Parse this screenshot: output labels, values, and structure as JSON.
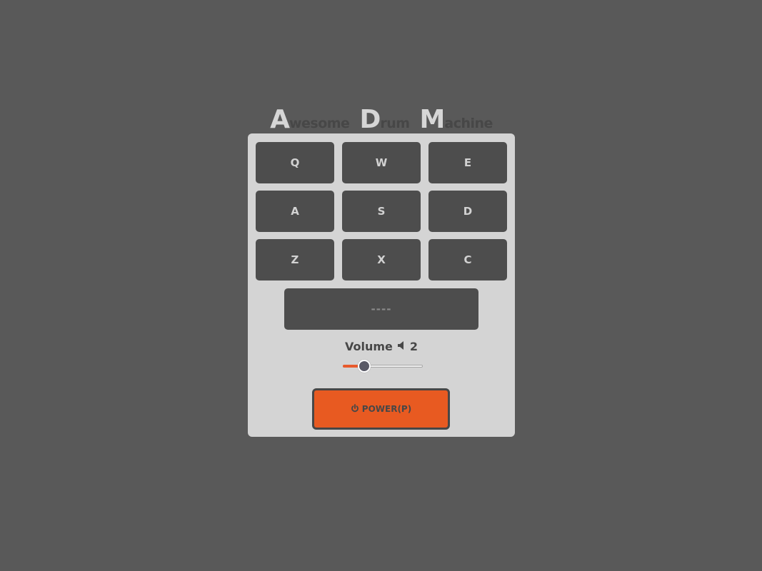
{
  "title": {
    "words": [
      {
        "initial": "A",
        "rest": "wesome"
      },
      {
        "initial": "D",
        "rest": "rum"
      },
      {
        "initial": "M",
        "rest": "achine"
      }
    ]
  },
  "pads": {
    "row1": [
      "Q",
      "W",
      "E"
    ],
    "row2": [
      "A",
      "S",
      "D"
    ],
    "row3": [
      "Z",
      "X",
      "C"
    ]
  },
  "display": {
    "text": "----"
  },
  "volume": {
    "label": "Volume",
    "value": "2",
    "icon": "speaker-icon",
    "fraction": 0.27
  },
  "power": {
    "label": "POWER(P)",
    "icon": "power-icon"
  },
  "colors": {
    "background": "#595959",
    "panel": "#d4d4d4",
    "pad": "#4d4d4d",
    "accent": "#e85a21"
  }
}
